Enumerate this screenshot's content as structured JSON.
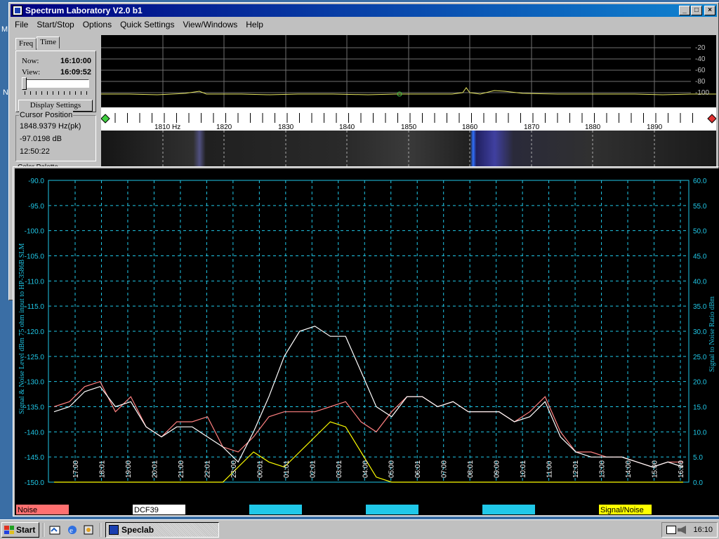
{
  "window": {
    "title": "Spectrum Laboratory V2.0 b1",
    "buttons": [
      "_",
      "□",
      "×"
    ]
  },
  "menu": [
    "File",
    "Start/Stop",
    "Options",
    "Quick Settings",
    "View/Windows",
    "Help"
  ],
  "left_panel": {
    "tabs": [
      "Freq",
      "Time"
    ],
    "now_label": "Now:",
    "now_value": "16:10:00",
    "view_label": "View:",
    "view_value": "16:09:52",
    "display_settings": "Display Settings",
    "cursor_title": "Cursor Position",
    "cursor_freq": "1848.9379 Hz(pk)",
    "cursor_level": "-97.0198 dB",
    "cursor_time": "12:50:22",
    "color_palette": "Color Palette"
  },
  "spectrum": {
    "db_labels": [
      "-20",
      "-40",
      "-60",
      "-80",
      "-100"
    ],
    "freq_labels": [
      "1810 Hz",
      "1820",
      "1830",
      "1840",
      "1850",
      "1860",
      "1870",
      "1880",
      "1890"
    ]
  },
  "desktop_edge_letters": [
    "M",
    "N"
  ],
  "chart_data": {
    "type": "line",
    "ylabel": "Signal & Noise Level dBm 75 ohm input to HP-3586B SLM",
    "y2label": "Signal to Noise Ratio dBm",
    "ylim": [
      -150,
      -90
    ],
    "y_ticks": [
      "-90.0",
      "-95.0",
      "-100.0",
      "-105.0",
      "-110.0",
      "-115.0",
      "-120.0",
      "-125.0",
      "-130.0",
      "-135.0",
      "-140.0",
      "-145.0",
      "-150.0"
    ],
    "y2lim": [
      0,
      60
    ],
    "y2_ticks": [
      "60.0",
      "55.0",
      "50.0",
      "45.0",
      "40.0",
      "35.0",
      "30.0",
      "25.0",
      "20.0",
      "15.0",
      "10.0",
      "5.0",
      "0.0"
    ],
    "x_ticks": [
      "17:00",
      "18:01",
      "19:00",
      "20:01",
      "21:00",
      "22:01",
      "23:00",
      "00:01",
      "01:01",
      "02:01",
      "03:01",
      "04:00",
      "05:00",
      "06:01",
      "07:00",
      "08:01",
      "09:00",
      "10:01",
      "11:00",
      "12:01",
      "13:00",
      "14:00",
      "15:00",
      "16:00"
    ],
    "grid": true,
    "legend": [
      "Noise",
      "DCF39",
      "",
      "",
      "",
      "Signal/Noise"
    ],
    "legend_colors": [
      "#ff7070",
      "#ffffff",
      "#20c8e8",
      "#20c8e8",
      "#20c8e8",
      "#ffff00"
    ],
    "series": [
      {
        "name": "Noise",
        "color": "#ff8080",
        "values": [
          -135,
          -134,
          -131,
          -130,
          -136,
          -133,
          -139,
          -141,
          -138,
          -138,
          -137,
          -143,
          -144,
          -141,
          -137,
          -136,
          -136,
          -136,
          -135,
          -134,
          -138,
          -140,
          -136,
          -133,
          -133,
          -135,
          -134,
          -136,
          -136,
          -136,
          -138,
          -136,
          -133,
          -140,
          -144,
          -144,
          -145,
          -145,
          -146,
          -147,
          -146,
          -146
        ]
      },
      {
        "name": "DCF39",
        "color": "#ffffff",
        "values": [
          -136,
          -135,
          -132,
          -131,
          -135,
          -134,
          -139,
          -141,
          -139,
          -139,
          -141,
          -143,
          -146,
          -140,
          -133,
          -125,
          -120,
          -119,
          -121,
          -121,
          -128,
          -135,
          -137,
          -133,
          -133,
          -135,
          -134,
          -136,
          -136,
          -136,
          -138,
          -137,
          -134,
          -141,
          -144,
          -145,
          -145,
          -145,
          -146,
          -147,
          -146,
          -147
        ]
      },
      {
        "name": "Signal/Noise",
        "color": "#ffff00",
        "values": [
          0,
          0,
          0,
          0,
          0,
          0,
          0,
          0,
          0,
          0,
          0,
          0,
          3,
          6,
          4,
          3,
          6,
          9,
          12,
          11,
          6,
          1,
          0,
          0,
          0,
          0,
          0,
          0,
          0,
          0,
          0,
          0,
          0,
          0,
          0,
          0,
          0,
          0,
          0,
          0,
          0,
          0
        ]
      }
    ]
  },
  "taskbar": {
    "start": "Start",
    "app": "Speclab",
    "clock": "16:10"
  }
}
